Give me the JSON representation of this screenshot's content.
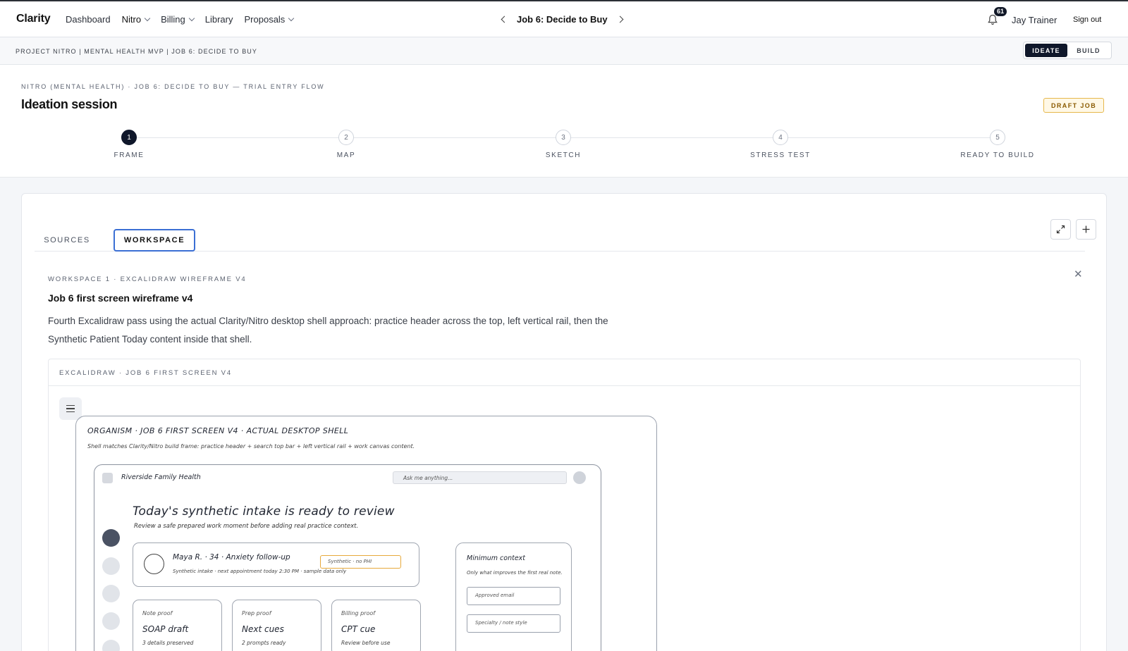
{
  "app": {
    "brand": "Clarity"
  },
  "nav": {
    "links": [
      {
        "label": "Dashboard",
        "has_menu": false
      },
      {
        "label": "Nitro",
        "has_menu": true,
        "active": true
      },
      {
        "label": "Billing",
        "has_menu": true
      },
      {
        "label": "Library",
        "has_menu": false
      },
      {
        "label": "Proposals",
        "has_menu": true
      }
    ],
    "job_title": "Job 6: Decide to Buy",
    "notifications_count": "61",
    "user_name": "Jay Trainer",
    "sign_out": "Sign out"
  },
  "breadcrumb": "PROJECT NITRO | MENTAL HEALTH MVP | JOB 6: DECIDE TO BUY",
  "mode_toggle": {
    "options": [
      "IDEATE",
      "BUILD"
    ],
    "selected": "IDEATE"
  },
  "session": {
    "eyebrow": "NITRO (MENTAL HEALTH) · JOB 6: DECIDE TO BUY — TRIAL ENTRY FLOW",
    "title": "Ideation session",
    "badge": "DRAFT JOB",
    "steps": [
      {
        "num": "1",
        "label": "FRAME",
        "active": true
      },
      {
        "num": "2",
        "label": "MAP"
      },
      {
        "num": "3",
        "label": "SKETCH"
      },
      {
        "num": "4",
        "label": "STRESS TEST"
      },
      {
        "num": "5",
        "label": "READY TO BUILD"
      }
    ]
  },
  "tabs": {
    "sources": "SOURCES",
    "workspace": "WORKSPACE",
    "selected": "WORKSPACE"
  },
  "workspace": {
    "eyebrow": "WORKSPACE 1 · EXCALIDRAW WIREFRAME V4",
    "title": "Job 6 first screen wireframe v4",
    "description": "Fourth Excalidraw pass using the actual Clarity/Nitro desktop shell approach: practice header across the top, left vertical rail, then the Synthetic Patient Today content inside that shell.",
    "frame_label": "EXCALIDRAW · JOB 6 FIRST SCREEN V4"
  },
  "sketch": {
    "title": "ORGANISM · JOB 6 FIRST SCREEN V4 · ACTUAL DESKTOP SHELL",
    "subtitle": "Shell matches Clarity/Nitro build frame: practice header + search top bar + left vertical rail + work canvas content.",
    "practice_name": "Riverside Family Health",
    "search_placeholder": "Ask me anything...",
    "headline": "Today's synthetic intake is ready to review",
    "subheadline": "Review a safe prepared work moment before adding real practice context.",
    "patient": {
      "name": "Maya R. · 34 · Anxiety follow-up",
      "meta": "Synthetic intake · next appointment today 2:30 PM · sample data only",
      "tag": "Synthetic · no PHI"
    },
    "proofs": [
      {
        "label": "Note proof",
        "value": "SOAP draft",
        "note": "3 details preserved"
      },
      {
        "label": "Prep proof",
        "value": "Next cues",
        "note": "2 prompts ready"
      },
      {
        "label": "Billing proof",
        "value": "CPT cue",
        "note": "Review before use"
      }
    ],
    "min_context": {
      "title": "Minimum context",
      "subtitle": "Only what improves the first real note.",
      "fields": [
        "Approved email",
        "Specialty / note style"
      ]
    }
  },
  "colors": {
    "primary_dark": "#0f172a",
    "tab_focus": "#3b6fd4",
    "draft_border": "#e6b84c",
    "synthetic_tag": "#e7a93c"
  }
}
